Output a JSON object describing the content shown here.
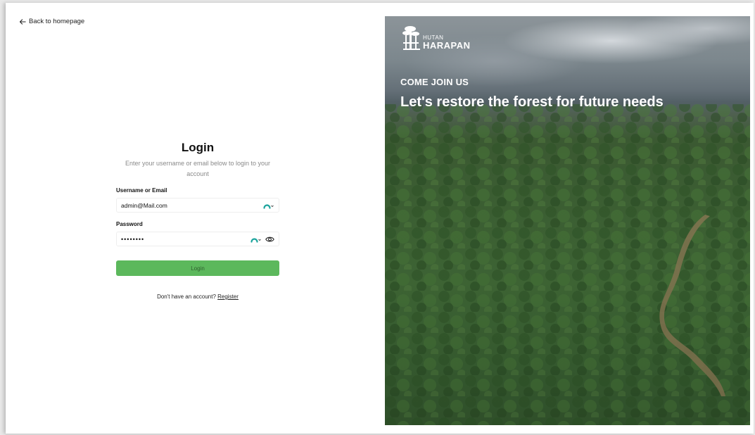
{
  "nav": {
    "back_label": "Back to homepage"
  },
  "login": {
    "title": "Login",
    "subtitle": "Enter your username or email below to login to your account",
    "username": {
      "label": "Username or Email",
      "value": "admin@Mail.com"
    },
    "password": {
      "label": "Password",
      "value": "••••••••"
    },
    "submit_label": "Login",
    "register_prompt": "Don't have an account?",
    "register_link": "Register"
  },
  "hero": {
    "brand_small": "HUTAN",
    "brand_big": "HARAPAN",
    "eyebrow": "COME JOIN US",
    "headline": "Let's restore the forest for future needs"
  },
  "colors": {
    "primary_button": "#5cb85c",
    "button_text": "#2f5f2f",
    "page_bg": "#ffffff",
    "muted_text": "#8a8a8a",
    "password_manager_accent": "#1ba39c"
  },
  "icons": {
    "back": "arrow-left-icon",
    "password_manager": "password-manager-icon",
    "show_password": "eye-icon",
    "logo": "tree-logo-icon"
  }
}
